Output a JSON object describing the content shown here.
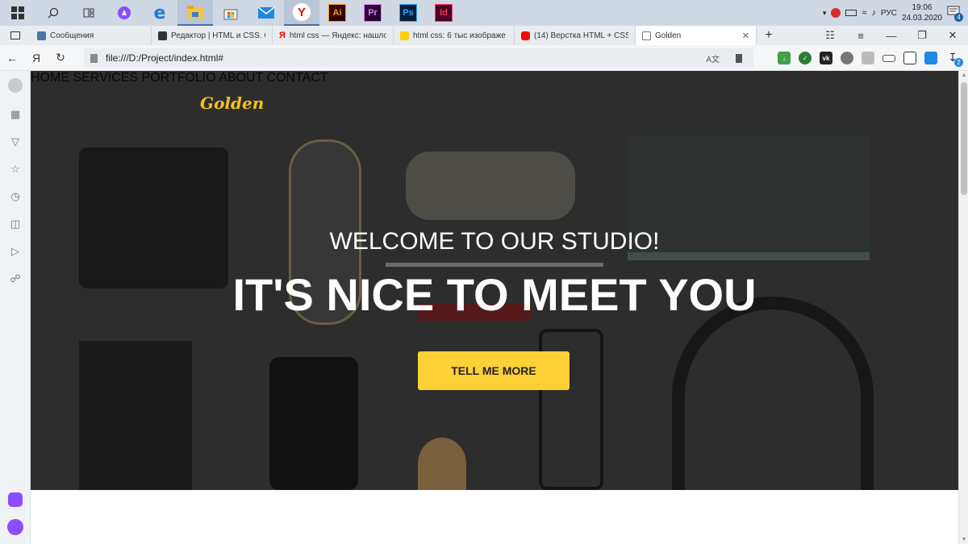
{
  "taskbar": {
    "apps": [
      {
        "name": "windows-start",
        "label": ""
      },
      {
        "name": "search",
        "label": ""
      },
      {
        "name": "task-view",
        "label": ""
      },
      {
        "name": "alice",
        "label": ""
      },
      {
        "name": "edge",
        "label": "e"
      },
      {
        "name": "file-explorer",
        "label": ""
      },
      {
        "name": "store",
        "label": ""
      },
      {
        "name": "mail",
        "label": ""
      },
      {
        "name": "yandex-browser",
        "label": "Y"
      },
      {
        "name": "illustrator",
        "label": "Ai"
      },
      {
        "name": "premiere",
        "label": "Pr"
      },
      {
        "name": "photoshop",
        "label": "Ps"
      },
      {
        "name": "indesign",
        "label": "Id"
      }
    ],
    "tray": {
      "language": "РУС",
      "time": "19:06",
      "date": "24.03.2020",
      "notifications": "4"
    }
  },
  "tabs": [
    {
      "label": "Сообщения",
      "favicon_color": "#4a76a8"
    },
    {
      "label": "Редактор | HTML и CSS. О",
      "favicon_color": "#333333"
    },
    {
      "label": "html css — Яндекс: нашло",
      "favicon_color": "#ff0000"
    },
    {
      "label": "html css: 6 тыс изображе",
      "favicon_color": "#ffcc00"
    },
    {
      "label": "(14) Верстка HTML + CSS",
      "favicon_color": "#ff0000"
    },
    {
      "label": "Golden",
      "favicon_color": "#ffffff"
    }
  ],
  "address": {
    "yandex_letter": "Я",
    "url": "file:///D:/Project/index.html#",
    "download_badge": "2"
  },
  "page": {
    "logo": "Golden",
    "nav": [
      "HOME",
      "SERVICES",
      "PORTFOLIO",
      "ABOUT",
      "CONTACT"
    ],
    "welcome": "WELCOME TO OUR STUDIO!",
    "headline": "IT'S NICE TO MEET YOU",
    "cta": "TELL ME MORE",
    "accent_color": "#fed136",
    "logo_color": "#f2c21b"
  }
}
